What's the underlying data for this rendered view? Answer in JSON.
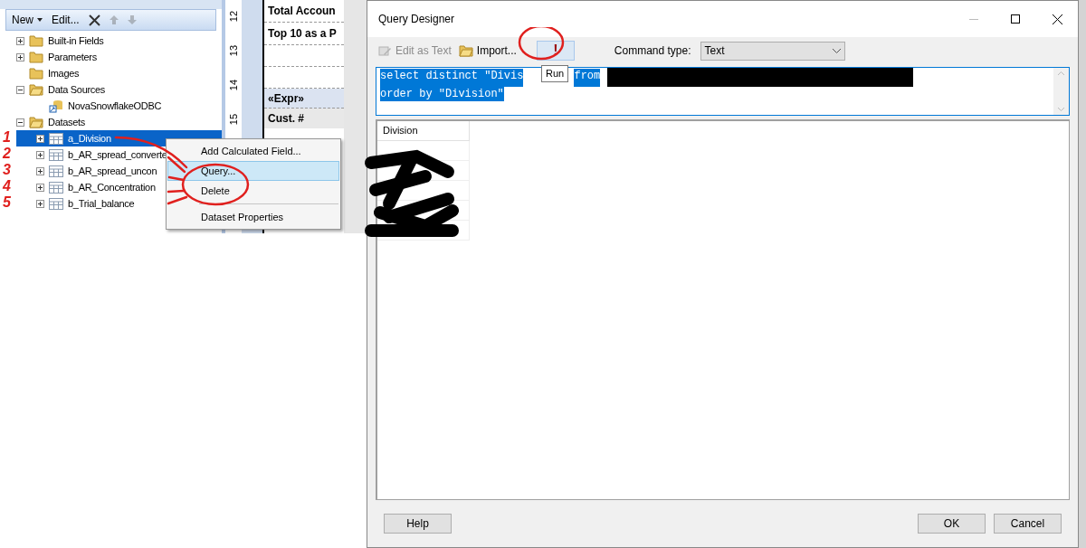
{
  "report_data_panel": {
    "toolbar": [
      {
        "kind": "menu",
        "label": "New",
        "disabled": false
      },
      {
        "kind": "text",
        "label": "Edit...",
        "disabled": false
      },
      {
        "kind": "delete",
        "disabled": false
      },
      {
        "kind": "up",
        "disabled": true
      },
      {
        "kind": "down",
        "disabled": true
      }
    ],
    "tree": [
      {
        "label": "Built-in Fields",
        "kind": "folder",
        "expanded": false,
        "selected": false
      },
      {
        "label": "Parameters",
        "kind": "folder",
        "expanded": false,
        "selected": false
      },
      {
        "label": "Images",
        "kind": "folder",
        "selected": false
      },
      {
        "label": "Data Sources",
        "kind": "folder",
        "expanded": true,
        "selected": false,
        "children": [
          {
            "label": "NovaSnowflakeODBC",
            "kind": "datasource",
            "selected": false
          }
        ]
      },
      {
        "label": "Datasets",
        "kind": "folder",
        "expanded": true,
        "selected": false,
        "children": [
          {
            "label": "a_Division",
            "kind": "dataset",
            "expanded": false,
            "selected": true
          },
          {
            "label": "b_AR_spread_converte",
            "kind": "dataset",
            "expanded": false,
            "selected": false
          },
          {
            "label": "b_AR_spread_uncon",
            "kind": "dataset",
            "expanded": false,
            "selected": false
          },
          {
            "label": "b_AR_Concentration",
            "kind": "dataset",
            "expanded": false,
            "selected": false
          },
          {
            "label": "b_Trial_balance",
            "kind": "dataset",
            "expanded": false,
            "selected": false
          }
        ]
      }
    ]
  },
  "ruler": [
    "12",
    "13",
    "14",
    "15"
  ],
  "report": [
    {
      "text": "Total Accoun",
      "kind": "title"
    },
    {
      "text": "Top 10 as a P",
      "kind": "title"
    },
    {
      "kind": "blank"
    },
    {
      "kind": "blank"
    },
    {
      "text": "«Expr»",
      "kind": "group"
    },
    {
      "text": "Cust. #",
      "kind": "header"
    }
  ],
  "context_menu": [
    {
      "kind": "item",
      "label": "Add Calculated Field...",
      "selected": false
    },
    {
      "kind": "item",
      "label": "Query...",
      "selected": true
    },
    {
      "kind": "item",
      "label": "Delete",
      "selected": false
    },
    {
      "kind": "separator"
    },
    {
      "kind": "item",
      "label": "Dataset Properties",
      "selected": false
    }
  ],
  "dialog": {
    "title": "Query Designer",
    "toolbar": [
      {
        "kind": "edit",
        "label": "Edit as Text",
        "disabled": true
      },
      {
        "kind": "import",
        "label": "Import...",
        "disabled": false
      },
      {
        "kind": "run",
        "label": "!",
        "disabled": false
      }
    ],
    "tooltip": "Run",
    "command_type": {
      "label": "Command type:",
      "value": "Text"
    },
    "query_lines": [
      [
        "select distinct \"Divis",
        "from"
      ],
      [
        "order by \"Division\""
      ]
    ],
    "grid": {
      "columns": [
        "Division"
      ],
      "row_count_cells": [
        {},
        {},
        {},
        {},
        {}
      ]
    },
    "buttons": [
      {
        "kind": "help",
        "label": "Help"
      },
      {
        "kind": "ok",
        "label": "OK"
      },
      {
        "kind": "cancel",
        "label": "Cancel"
      }
    ]
  },
  "annotations": [
    "1",
    "2",
    "3",
    "4",
    "5"
  ]
}
